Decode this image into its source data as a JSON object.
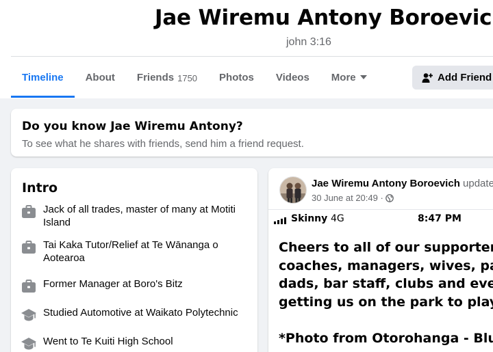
{
  "profile": {
    "name": "Jae Wiremu Antony Boroevich",
    "bio": "john 3:16"
  },
  "tabs": [
    {
      "label": "Timeline",
      "active": true
    },
    {
      "label": "About"
    },
    {
      "label": "Friends",
      "count": "1750"
    },
    {
      "label": "Photos"
    },
    {
      "label": "Videos"
    },
    {
      "label": "More",
      "icon": "caret-down-icon"
    }
  ],
  "actions": {
    "add_friend_label": "Add Friend",
    "add_friend_icon": "add-person-icon"
  },
  "know_card": {
    "title": "Do you know Jae Wiremu Antony?",
    "subtitle": "To see what he shares with friends, send him a friend request."
  },
  "intro": {
    "title": "Intro",
    "items": [
      {
        "icon": "briefcase-icon",
        "prefix": "Jack of all trades, master of many at ",
        "place": "Motiti Island"
      },
      {
        "icon": "briefcase-icon",
        "prefix": "Tai Kaka Tutor/Relief at ",
        "place": "Te Wānanga o Aotearoa"
      },
      {
        "icon": "briefcase-icon",
        "prefix": "Former Manager at ",
        "place": "Boro's Bitz"
      },
      {
        "icon": "graduation-cap-icon",
        "prefix": "Studied Automotive at ",
        "place": "Waikato Polytechnic"
      },
      {
        "icon": "graduation-cap-icon",
        "prefix": "Went to ",
        "place": "Te Kuiti High School"
      }
    ]
  },
  "post": {
    "author": "Jae Wiremu Antony Boroevich",
    "action": "updated",
    "time": "30 June at 20:49 ·",
    "privacy_icon": "globe-icon",
    "screenshot": {
      "carrier": "Skinny",
      "network": "4G",
      "clock": "8:47 PM",
      "lines": [
        "Cheers to all of our supporters, t",
        "coaches, managers, wives, part",
        "dads, bar staff, clubs and everye",
        "getting us on the park to play th"
      ],
      "caption": "*Photo from Otorohanga - Blue I"
    }
  },
  "colors": {
    "accent": "#1877f2",
    "secondary_text": "#65676b",
    "background": "#f0f2f5"
  }
}
